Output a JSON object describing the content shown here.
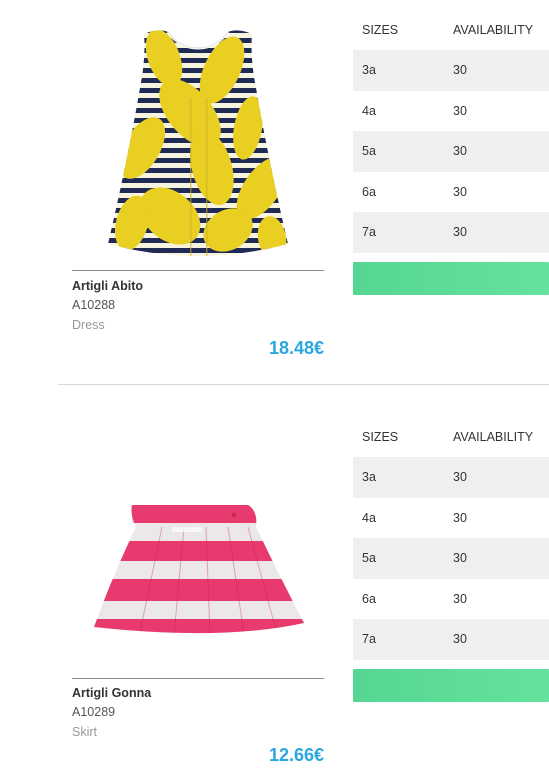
{
  "products": [
    {
      "name": "Artigli Abito",
      "code": "A10288",
      "type": "Dress",
      "price": "18.48€",
      "table": {
        "header_sizes": "SIZES",
        "header_availability": "AVAILABILITY",
        "rows": [
          {
            "size": "3a",
            "availability": "30"
          },
          {
            "size": "4a",
            "availability": "30"
          },
          {
            "size": "5a",
            "availability": "30"
          },
          {
            "size": "6a",
            "availability": "30"
          },
          {
            "size": "7a",
            "availability": "30"
          }
        ]
      },
      "button_color": "#5cdc97"
    },
    {
      "name": "Artigli Gonna",
      "code": "A10289",
      "type": "Skirt",
      "price": "12.66€",
      "table": {
        "header_sizes": "SIZES",
        "header_availability": "AVAILABILITY",
        "rows": [
          {
            "size": "3a",
            "availability": "30"
          },
          {
            "size": "4a",
            "availability": "30"
          },
          {
            "size": "5a",
            "availability": "30"
          },
          {
            "size": "6a",
            "availability": "30"
          },
          {
            "size": "7a",
            "availability": "30"
          }
        ]
      },
      "button_color": "#5cdc97"
    }
  ],
  "colors": {
    "price": "#29a8e0",
    "dress_yellow": "#e8cf22",
    "dress_navy": "#1f2a55",
    "skirt_pink": "#e83a6e"
  },
  "icons": {
    "dress_image": "dress-image",
    "skirt_image": "skirt-image"
  }
}
